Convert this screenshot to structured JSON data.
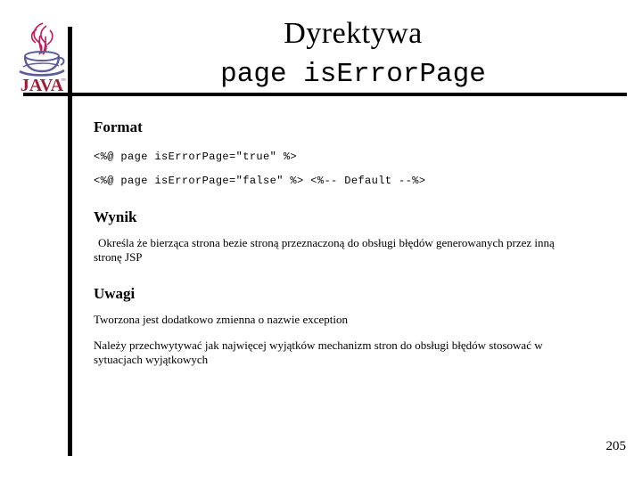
{
  "slide": {
    "title_line_1": "Dyrektywa",
    "title_line_2": "page isErrorPage",
    "page_number": "205",
    "logo_alt": "JAVA",
    "logo_wordmark": "JAVA",
    "colors": {
      "rule": "#000000",
      "text": "#000000",
      "logo_red": "#9E1B32",
      "logo_steam": "#C2185B",
      "logo_cup": "#5B5B9F",
      "background": "#FFFFFF"
    }
  },
  "sections": {
    "format": {
      "heading": "Format",
      "code_lines": [
        "<%@ page isErrorPage=\"true\" %>",
        "<%@ page isErrorPage=\"false\" %> <%-- Default --%>"
      ]
    },
    "wynik": {
      "heading": "Wynik",
      "paragraphs": [
        "Określa że bierząca strona bezie stroną przeznaczoną do obsługi błędów generowanych przez inną stronę JSP"
      ]
    },
    "uwagi": {
      "heading": "Uwagi",
      "paragraphs": [
        "Tworzona jest dodatkowo zmienna o nazwie exception",
        "Należy przechwytywać jak najwięcej wyjątków mechanizm stron do obsługi błędów stosować w sytuacjach wyjątkowych"
      ]
    }
  }
}
